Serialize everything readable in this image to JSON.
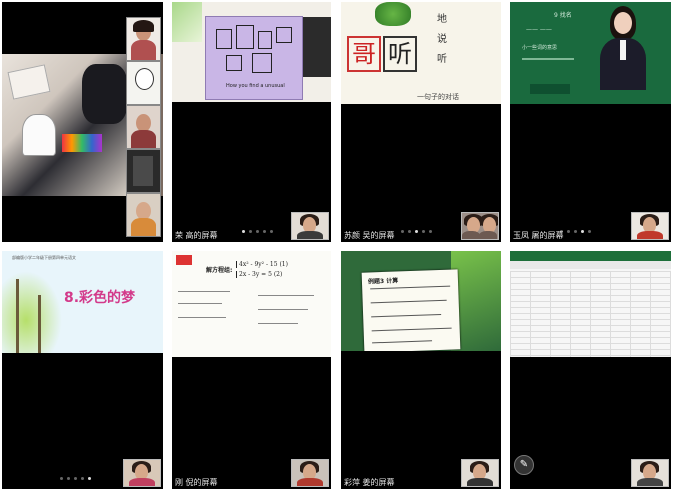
{
  "tiles": [
    {
      "label": "",
      "strip": [
        "",
        "",
        "",
        "",
        ""
      ]
    },
    {
      "label": "荣 高的屏幕",
      "slide_text": "How you find a unusual"
    },
    {
      "label": "苏颜 吴的屏幕",
      "chars": [
        "地",
        "说",
        "听",
        "哥",
        "听"
      ],
      "caption": "一句子的对话"
    },
    {
      "label": "玉凤 屠的屏幕",
      "slide_title": "9 找名",
      "slide_sub": "小一些词的意思"
    },
    {
      "label": "",
      "lesson_title": "8.彩色的梦",
      "lesson_header": "部编版小学二年级下册第四单元语文"
    },
    {
      "label": "刚 倪的屏幕",
      "method": "解方程组:",
      "eq1": "4x² - 9y² - 15     (1)",
      "eq2": "2x - 3y = 5        (2)"
    },
    {
      "label": "彩萍 姜的屏幕",
      "example": "例题3  计算"
    },
    {
      "label": "",
      "spreadsheet": "Excel"
    }
  ],
  "colors": {
    "tile_bg": "#000000",
    "dot_active": "#dddddd",
    "dot_idle": "#666666"
  }
}
